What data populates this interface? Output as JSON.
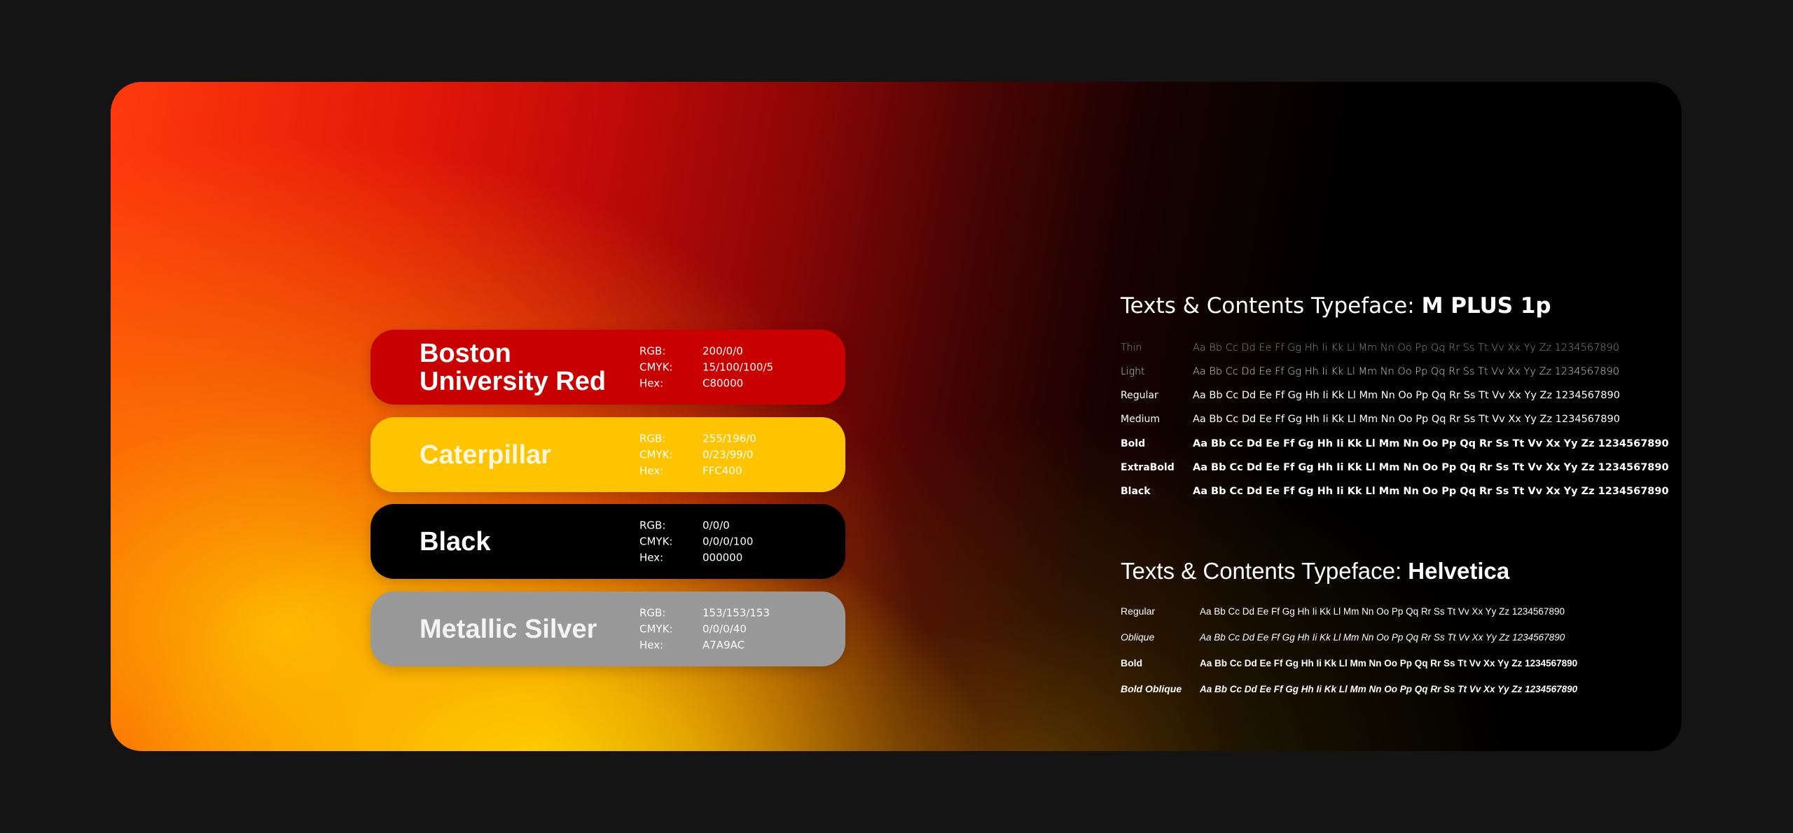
{
  "swatches": [
    {
      "name": "Boston University Red",
      "name_line1": "Boston",
      "name_line2": "University Red",
      "rgb": "200/0/0",
      "cmyk": "15/100/100/5",
      "hex": "C80000",
      "color": "#c80000"
    },
    {
      "name": "Caterpillar",
      "rgb": "255/196/0",
      "cmyk": "0/23/99/0",
      "hex": "FFC400",
      "color": "#ffc400"
    },
    {
      "name": "Black",
      "rgb": "0/0/0",
      "cmyk": "0/0/0/100",
      "hex": "000000",
      "color": "#000000"
    },
    {
      "name": "Metallic Silver",
      "rgb": "153/153/153",
      "cmyk": "0/0/0/40",
      "hex": "A7A9AC",
      "color": "#999999"
    }
  ],
  "spec_labels": {
    "rgb": "RGB:",
    "cmyk": "CMYK:",
    "hex": "Hex:"
  },
  "typefaces": [
    {
      "title_prefix": "Texts & Contents Typeface: ",
      "title_font": "M PLUS 1p",
      "sample": "Aa Bb Cc Dd Ee Ff Gg Hh Ii Kk Ll Mm Nn Oo Pp Qq Rr Ss Tt Vv Xx Yy Zz 1234567890",
      "weights": [
        "Thin",
        "Light",
        "Regular",
        "Medium",
        "Bold",
        "ExtraBold",
        "Black"
      ]
    },
    {
      "title_prefix": "Texts & Contents Typeface: ",
      "title_font": "Helvetica",
      "sample": "Aa Bb Cc Dd Ee Ff Gg Hh Ii Kk Ll Mm Nn Oo Pp Qq Rr Ss Tt Vv Xx Yy Zz 1234567890",
      "weights": [
        "Regular",
        "Oblique",
        "Bold",
        "Bold Oblique"
      ]
    }
  ]
}
